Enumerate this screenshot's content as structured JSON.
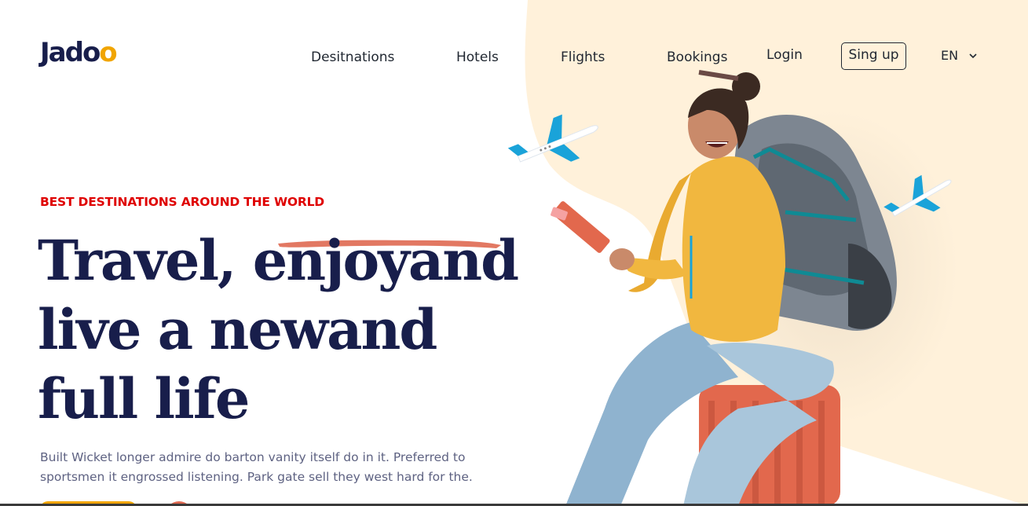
{
  "brand": {
    "logo_text": "Jadoo",
    "accent": "#f1a501",
    "dark": "#181e4b"
  },
  "nav": {
    "items": [
      {
        "label": "Desitnations"
      },
      {
        "label": "Hotels"
      },
      {
        "label": "Flights"
      },
      {
        "label": "Bookings"
      }
    ],
    "login_label": "Login",
    "signup_label": "Sing up",
    "language": "EN",
    "language_icon": "chevron-down-icon"
  },
  "hero": {
    "eyebrow": "BEST DESTINATIONS AROUND THE WORLD",
    "headline_lines": [
      "Travel, enjoyand",
      "live a newand",
      "full life"
    ],
    "description": "Built Wicket longer admire do barton vanity itself do in it. Preferred to sportsmen it engrossed listening. Park gate sell they west hard for the.",
    "colors": {
      "eyebrow": "#df0000",
      "headline": "#181e4b",
      "description": "#5e6282",
      "underline": "#df6951",
      "blob": "#fff1da"
    },
    "illustration": "traveler-with-backpack-and-planes"
  }
}
